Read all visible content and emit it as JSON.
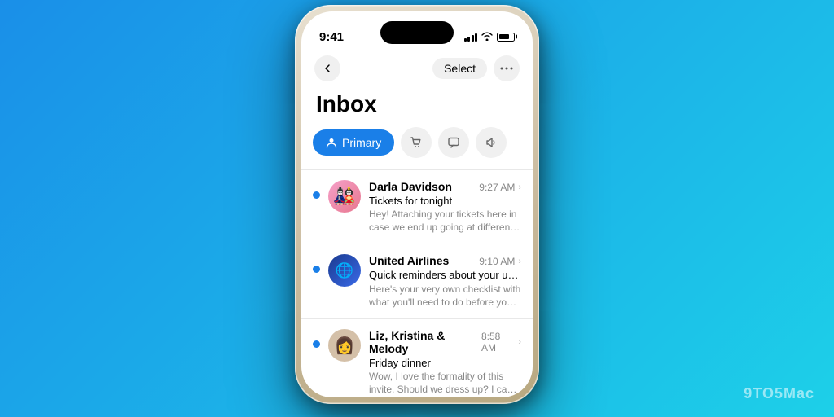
{
  "watermark": "9TO5Mac",
  "phone": {
    "status_bar": {
      "time": "9:41",
      "signal_label": "signal",
      "wifi_label": "wifi",
      "battery_label": "battery"
    },
    "nav": {
      "back_label": "‹",
      "select_label": "Select",
      "more_label": "···"
    },
    "title": "Inbox",
    "tabs": [
      {
        "id": "primary",
        "label": "Primary",
        "icon": "person",
        "active": true
      },
      {
        "id": "shopping",
        "label": "Shopping",
        "icon": "cart",
        "active": false
      },
      {
        "id": "social",
        "label": "Social",
        "icon": "chat",
        "active": false
      },
      {
        "id": "promotions",
        "label": "Promotions",
        "icon": "megaphone",
        "active": false
      }
    ],
    "emails": [
      {
        "id": "email-1",
        "sender": "Darla Davidson",
        "time": "9:27 AM",
        "subject": "Tickets for tonight",
        "preview": "Hey! Attaching your tickets here in case we end up going at different times. Can't wait!",
        "unread": true,
        "avatar_emoji": "🎎",
        "avatar_bg": "#e87890",
        "shopping_badge": false
      },
      {
        "id": "email-2",
        "sender": "United Airlines",
        "time": "9:10 AM",
        "subject": "Quick reminders about your upcoming...",
        "preview": "Here's your very own checklist with what you'll need to do before your flight and wh...",
        "unread": true,
        "avatar_emoji": "🌐",
        "avatar_bg": "#1a3a8f",
        "shopping_badge": true
      },
      {
        "id": "email-3",
        "sender": "Liz, Kristina & Melody",
        "time": "8:58 AM",
        "subject": "Friday dinner",
        "preview": "Wow, I love the formality of this invite. Should we dress up? I can pull out my prom dress...",
        "unread": true,
        "avatar_emoji": "👩",
        "avatar_bg": "#d0c0b0",
        "shopping_badge": false
      }
    ]
  }
}
